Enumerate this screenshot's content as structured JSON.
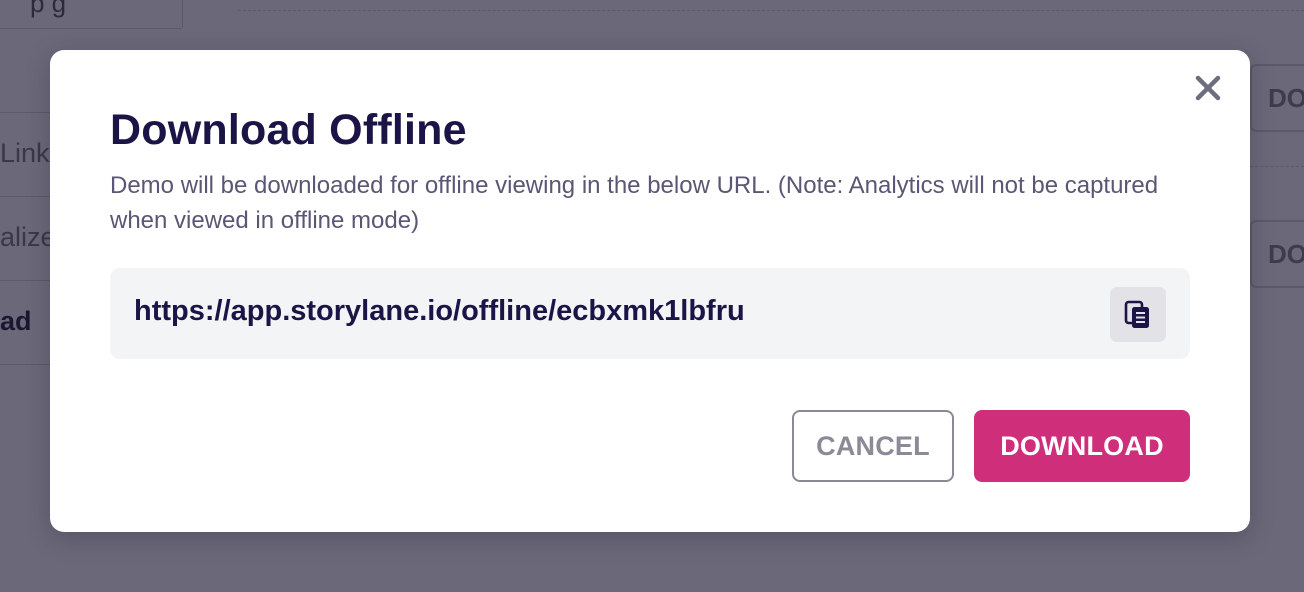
{
  "background": {
    "side_fragments": [
      "Link",
      "alize",
      "ad"
    ],
    "right_button_fragment": "DO",
    "top_fragment": "p g"
  },
  "modal": {
    "title": "Download Offline",
    "description": "Demo will be downloaded for offline viewing in the below URL. (Note: Analytics will not be captured when viewed in offline mode)",
    "url": "https://app.storylane.io/offline/ecbxmk1lbfru",
    "close_icon": "close-icon",
    "copy_icon": "copy-icon",
    "cancel_label": "CANCEL",
    "download_label": "DOWNLOAD"
  },
  "colors": {
    "overlay": "#6b6979",
    "title": "#1a1546",
    "accent": "#cf2e7a"
  }
}
